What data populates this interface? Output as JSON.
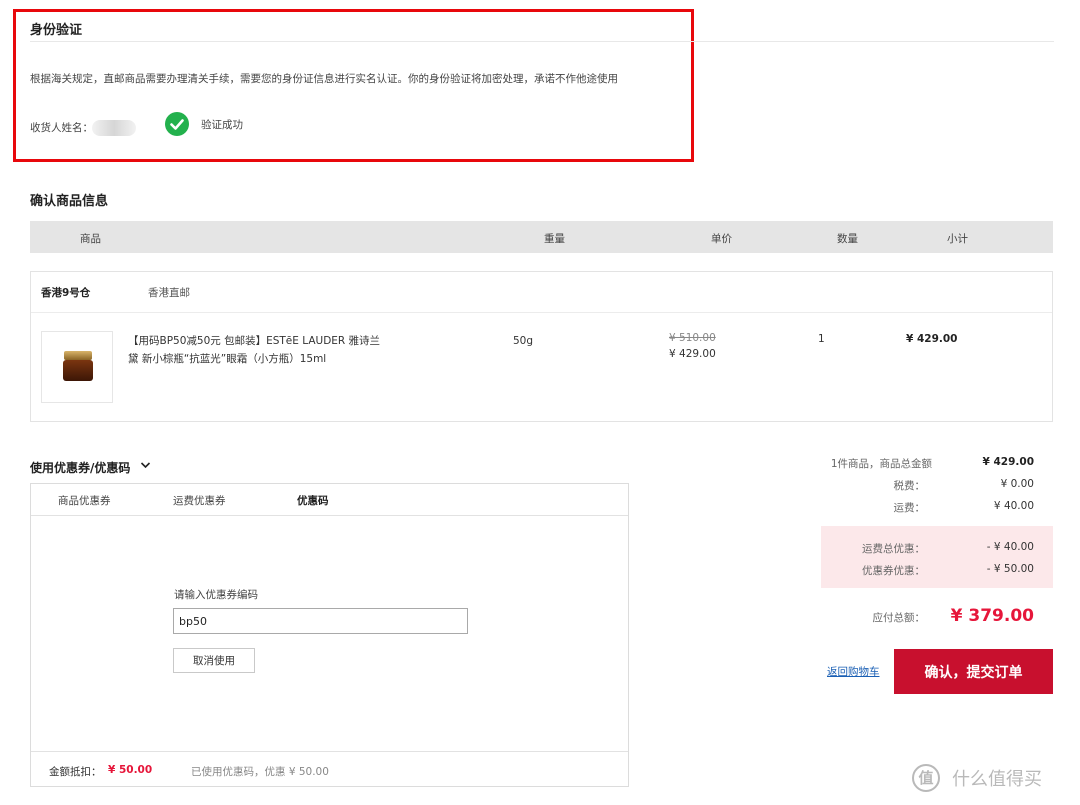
{
  "identity": {
    "title": "身份验证",
    "description": "根据海关规定，直邮商品需要办理清关手续，需要您的身份证信息进行实名认证。你的身份验证将加密处理，承诺不作他途使用",
    "name_label": "收货人姓名：",
    "status": "验证成功",
    "status_icon": "check-circle-icon",
    "status_color": "#23b14d"
  },
  "products": {
    "title": "确认商品信息",
    "headers": [
      "商品",
      "重量",
      "单价",
      "数量",
      "小计"
    ],
    "warehouse": "香港9号仓",
    "shipping": "香港直邮",
    "item": {
      "name_line1": "【用码BP50减50元 包邮装】ESTēE LAUDER 雅诗兰",
      "name_line2": "黛 新小棕瓶“抗蓝光”眼霜（小方瓶）15ml",
      "weight": "50g",
      "original_price": "¥ 510.00",
      "price": "¥ 429.00",
      "quantity": "1",
      "subtotal": "¥ 429.00"
    }
  },
  "coupons": {
    "title": "使用优惠券/优惠码",
    "tabs": [
      "商品优惠券",
      "运费优惠券",
      "优惠码"
    ],
    "active_tab": "优惠码",
    "code_label": "请输入优惠券编码",
    "code_value": "bp50",
    "cancel_label": "取消使用",
    "deduct_label": "金额抵扣：",
    "deduct_value": "¥ 50.00",
    "used_note": "已使用优惠码，优惠 ¥ 50.00"
  },
  "summary": {
    "items_label": "1件商品，商品总金额",
    "items_value": "¥ 429.00",
    "tax_label": "税费：",
    "tax_value": "¥ 0.00",
    "shipping_label": "运费：",
    "shipping_value": "¥ 40.00",
    "shipping_discount_label": "运费总优惠：",
    "shipping_discount_value": "- ¥ 40.00",
    "coupon_discount_label": "优惠券优惠：",
    "coupon_discount_value": "- ¥ 50.00",
    "total_label": "应付总额：",
    "total_value": "¥ 379.00",
    "back_label": "返回购物车",
    "submit_label": "确认，提交订单",
    "accent_color": "#c8102e"
  },
  "watermark": {
    "symbol": "值",
    "text": "什么值得买"
  }
}
